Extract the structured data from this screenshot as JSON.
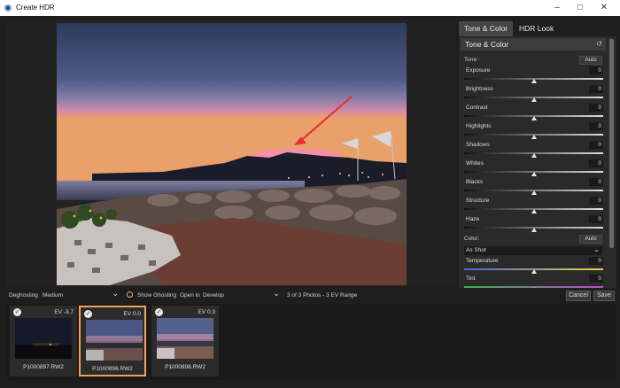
{
  "window": {
    "title": "Create HDR",
    "controls": [
      "minimize-icon",
      "maximize-icon",
      "close-icon"
    ]
  },
  "panel": {
    "tabs": [
      "Tone & Color",
      "HDR Look"
    ],
    "active_tab": "Tone & Color",
    "section_title": "Tone & Color",
    "tone_label": "Tone:",
    "auto_label": "Auto",
    "sliders": [
      {
        "label": "Exposure",
        "value": "0",
        "fraction": 0.5
      },
      {
        "label": "Brightness",
        "value": "0",
        "fraction": 0.5
      },
      {
        "label": "Contrast",
        "value": "0",
        "fraction": 0.5
      },
      {
        "label": "Highlights",
        "value": "0",
        "fraction": 0.5
      },
      {
        "label": "Shadows",
        "value": "0",
        "fraction": 0.5
      },
      {
        "label": "Whites",
        "value": "0",
        "fraction": 0.5
      },
      {
        "label": "Blacks",
        "value": "0",
        "fraction": 0.5
      },
      {
        "label": "Structure",
        "value": "0",
        "fraction": 0.5
      },
      {
        "label": "Haze",
        "value": "0",
        "fraction": 0.5
      }
    ],
    "color_label": "Color:",
    "color_auto_label": "Auto",
    "white_balance": "As Shot",
    "color_sliders": [
      {
        "label": "Temperature",
        "value": "0",
        "fraction": 0.5
      },
      {
        "label": "Tint",
        "value": "0",
        "fraction": 0.5
      }
    ]
  },
  "toolbar": {
    "deghosting_label": "Deghosting",
    "deghosting_value": "Medium",
    "show_ghosting": "Show Ghosting",
    "open_in_label": "Open in",
    "open_in_value": "Develop",
    "summary": "3 of 3 Photos - 3 EV Range",
    "cancel": "Cancel",
    "save": "Save"
  },
  "filmstrip": [
    {
      "ev": "EV -3.7",
      "name": "P1000897.RW2",
      "selected": false
    },
    {
      "ev": "EV 0.0",
      "name": "P1000896.RW2",
      "selected": true
    },
    {
      "ev": "EV 0.3",
      "name": "P1000898.RW2",
      "selected": false
    }
  ],
  "colors": {
    "selected_border": "#f0a25b",
    "panel_bg": "#2a2a2a",
    "app_bg": "#1e1e1e"
  }
}
